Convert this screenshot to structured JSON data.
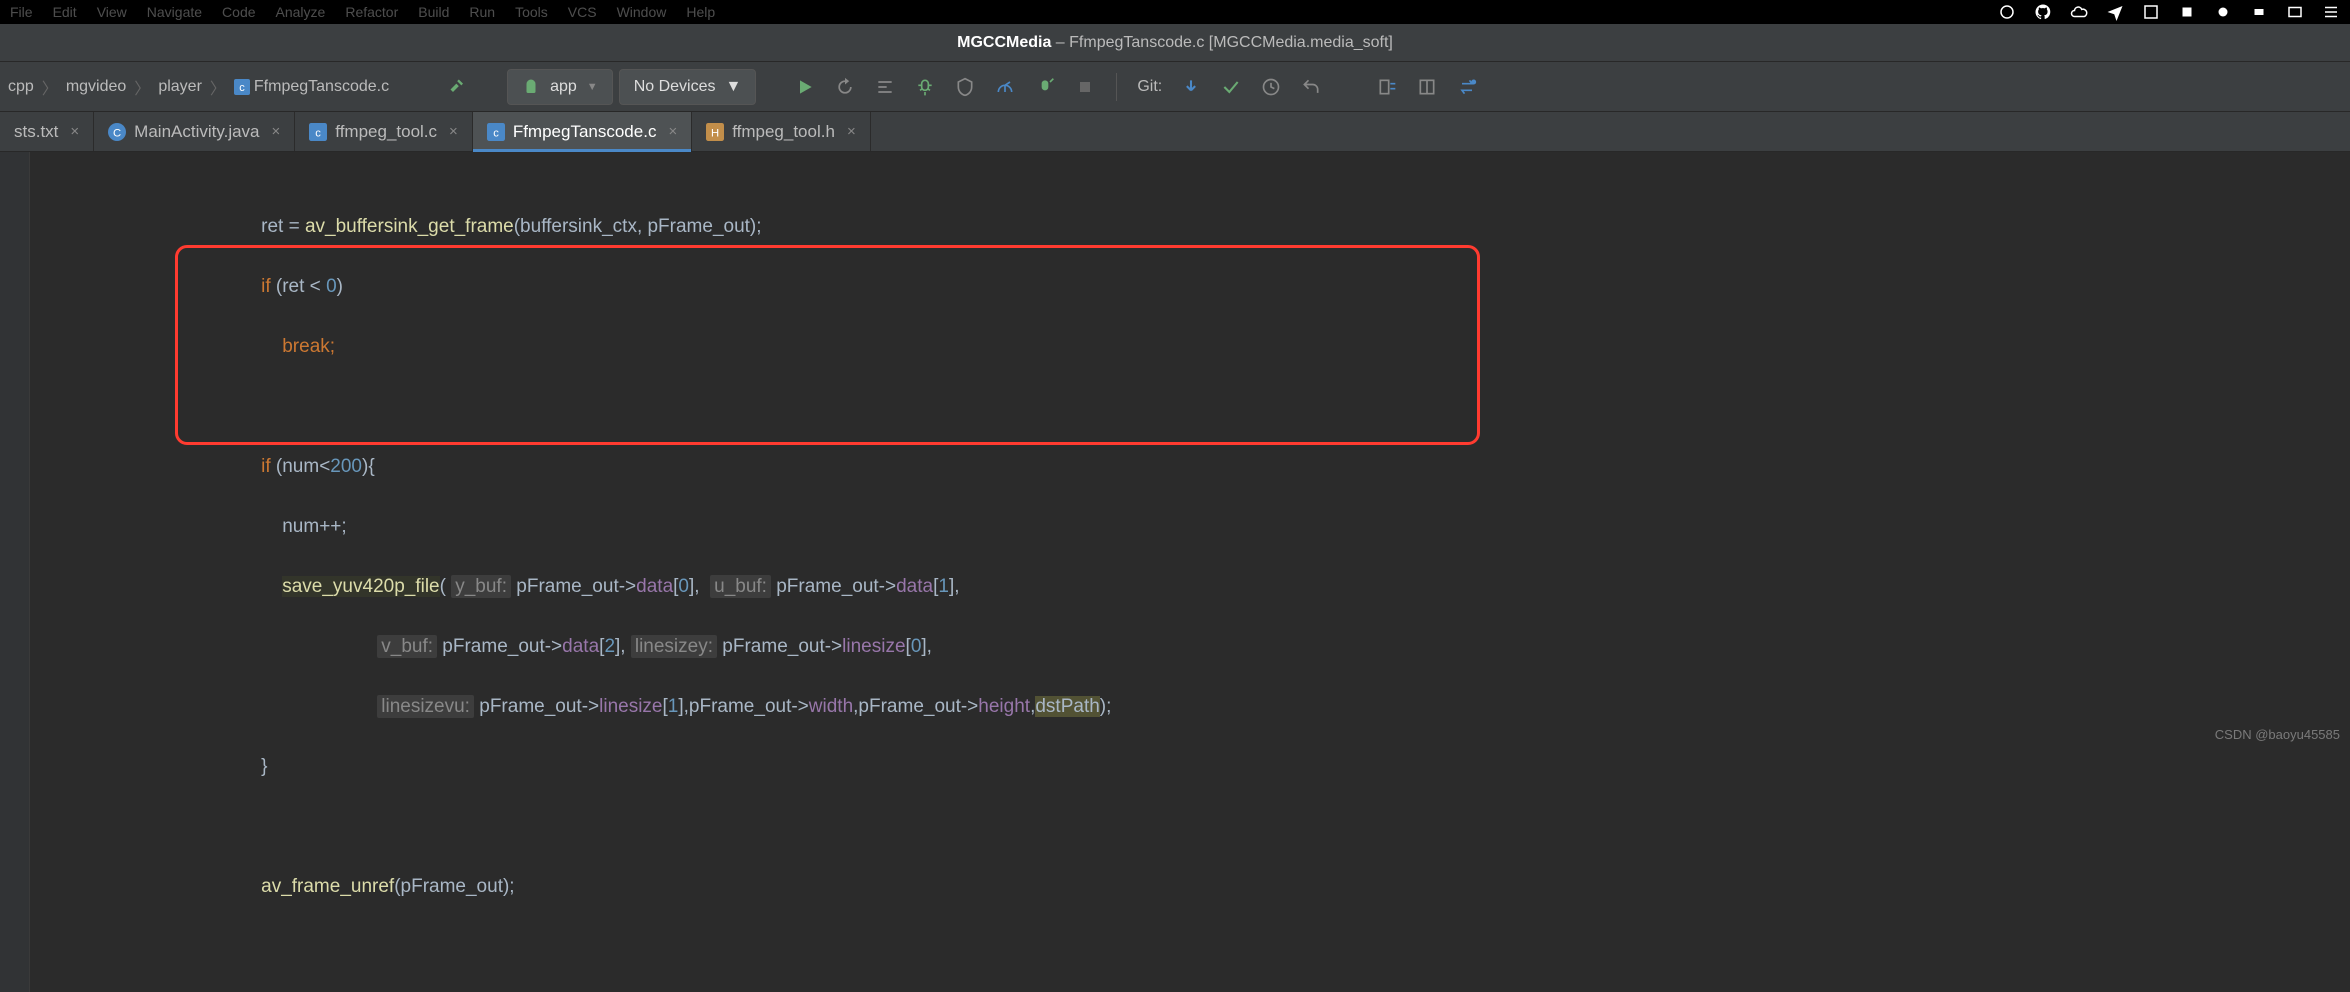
{
  "menubar": {
    "items": [
      "File",
      "Edit",
      "View",
      "Navigate",
      "Code",
      "Analyze",
      "Refactor",
      "Build",
      "Run",
      "Tools",
      "VCS",
      "Window",
      "Help"
    ]
  },
  "titlebar": {
    "project": "MGCCMedia",
    "file": "FfmpegTanscode.c",
    "module": "MGCCMedia.media_soft"
  },
  "breadcrumbs": {
    "items": [
      "cpp",
      "mgvideo",
      "player",
      "FfmpegTanscode.c"
    ]
  },
  "runconfig": {
    "app_label": "app",
    "device_label": "No Devices"
  },
  "git_label": "Git:",
  "tabs": [
    {
      "name": "sts.txt",
      "icon": "txt",
      "active": false
    },
    {
      "name": "MainActivity.java",
      "icon": "java",
      "active": false
    },
    {
      "name": "ffmpeg_tool.c",
      "icon": "c",
      "active": false
    },
    {
      "name": "FfmpegTanscode.c",
      "icon": "c",
      "active": true
    },
    {
      "name": "ffmpeg_tool.h",
      "icon": "h",
      "active": false
    }
  ],
  "code": {
    "l1_a": "ret = ",
    "l1_b": "av_buffersink_get_frame",
    "l1_c": "(buffersink_ctx, pFrame_out);",
    "l2_a": "if ",
    "l2_b": "(ret < ",
    "l2_c": "0",
    "l2_d": ")",
    "l3_a": "break;",
    "l5_a": "if ",
    "l5_b": "(num<",
    "l5_c": "200",
    "l5_d": "){",
    "l6_a": "num++;",
    "l7_a": "save_yuv420p_file",
    "l7_h1": "y_buf:",
    "l7_b": " pFrame_out->",
    "l7_c": "data",
    "l7_d": "[",
    "l7_e": "0",
    "l7_f": "],  ",
    "l7_h2": "u_buf:",
    "l7_g": " pFrame_out->",
    "l7_i": "data",
    "l7_j": "[",
    "l7_k": "1",
    "l7_l": "],",
    "l8_h1": "v_buf:",
    "l8_a": " pFrame_out->",
    "l8_b": "data",
    "l8_c": "[",
    "l8_d": "2",
    "l8_e": "], ",
    "l8_h2": "linesizey:",
    "l8_f": " pFrame_out->",
    "l8_g": "linesize",
    "l8_h": "[",
    "l8_i": "0",
    "l8_j": "],",
    "l9_h1": "linesizevu:",
    "l9_a": " pFrame_out->",
    "l9_b": "linesize",
    "l9_c": "[",
    "l9_d": "1",
    "l9_e": "],pFrame_out->",
    "l9_f": "width",
    "l9_g": ",pFrame_out->",
    "l9_h": "height",
    "l9_i": ",",
    "l9_j": "dstPath",
    "l9_k": ");",
    "l10_a": "}",
    "l12_a": "av_frame_unref",
    "l12_b": "(pFrame_out);"
  },
  "watermark": "CSDN @baoyu45585"
}
